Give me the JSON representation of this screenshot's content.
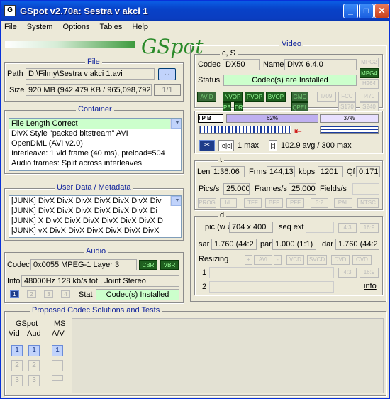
{
  "window": {
    "title": "GSpot v2.70a: Sestra v akci 1",
    "icon_text": "G"
  },
  "menu": [
    "File",
    "System",
    "Options",
    "Tables",
    "Help"
  ],
  "logo": "GSpot",
  "file": {
    "title": "File",
    "path_label": "Path",
    "path": "D:\\Filmy\\Sestra v akci 1.avi",
    "browse": "...",
    "size_label": "Size",
    "size": "920 MB (942,479 KB / 965,098,792",
    "part": "1/1"
  },
  "container": {
    "title": "Container",
    "lines": [
      "File Length Correct",
      "DivX Style \"packed bitstream\" AVI",
      "OpenDML (AVI v2.0)",
      "Interleave: 1 vid frame (40 ms), preload=504",
      "Audio frames: Split across interleaves"
    ]
  },
  "userdata": {
    "title": "User Data / Metadata",
    "lines": [
      "[JUNK]      DivX DivX DivX DivX DivX DivX Div",
      "[JUNK]       DivX DivX DivX DivX DivX DivX Di",
      "[JUNK]     X DivX DivX DivX DivX DivX DivX D",
      "[JUNK]     vX DivX DivX DivX DivX DivX DivX"
    ]
  },
  "audio": {
    "title": "Audio",
    "codec_label": "Codec",
    "codec": "0x0055 MPEG-1 Layer 3",
    "cbr": "CBR",
    "vbr": "VBR",
    "info_label": "Info",
    "info": "48000Hz  128 kb/s tot , Joint Stereo",
    "stat_label": "Stat",
    "stat": "Codec(s) Installed",
    "streams": [
      "1",
      "2",
      "3",
      "4"
    ]
  },
  "proposed": {
    "title": "Proposed Codec Solutions and Tests",
    "gspot": "GSpot",
    "vid": "Vid",
    "aud": "Aud",
    "ms": "MS",
    "av": "A/V",
    "nums": [
      "1",
      "2",
      "3"
    ]
  },
  "video": {
    "title": "Video",
    "cs": "c, S",
    "codec_label": "Codec",
    "codec": "DX50",
    "name_label": "Name",
    "name": "DivX 6.4.0",
    "status_label": "Status",
    "status": "Codec(s) are Installed",
    "tags_right": [
      "MPG2",
      "MPG4",
      "H264"
    ],
    "avid": "AVID",
    "nvop": "NVOP",
    "pvop": "PVOP",
    "bvop": "BVOP",
    "pb": "PB",
    "dr": "DR",
    "gmc": "GMC",
    "qpel": "QPEL",
    "i709": "I709",
    "fcc": "FCC",
    "i470": "I470",
    "s170": "S170",
    "s240": "S240",
    "ipb": [
      "I",
      "P",
      "B"
    ],
    "bar1": "62%",
    "bar2": "37%",
    "bframes": "1 max",
    "bitrate": "102.9 avg / 300 max",
    "t": "t",
    "len_label": "Len",
    "len": "1:36:06",
    "frms_label": "Frms",
    "frms": "144,13",
    "kbps_label": "kbps",
    "kbps": "1201",
    "qf_label": "Qf",
    "qf": "0.171",
    "pics_label": "Pics/s",
    "pics": "25.000",
    "frames_label": "Frames/s",
    "frames": "25.000",
    "fields_label": "Fields/s",
    "prog": [
      "PROG",
      "I/L",
      "TFF",
      "BFF",
      "PFF",
      "3:2",
      "PAL",
      "NTSC"
    ],
    "d": "d",
    "pic_label": "pic (w x h)",
    "pic": "704 x 400",
    "seqext_label": "seq ext",
    "r43": "4:3",
    "r169": "16:9",
    "sar_label": "sar",
    "sar": "1.760 (44:2",
    "par_label": "par",
    "par": "1.000 (1:1)",
    "dar_label": "dar",
    "dar": "1.760 (44:2",
    "resizing": "Resizing",
    "rs_btns": [
      "+",
      "AVI",
      "-",
      "VCD",
      "SVCD",
      "DVD",
      "CVD"
    ],
    "row1": "1",
    "row2": "2",
    "info": "info"
  }
}
